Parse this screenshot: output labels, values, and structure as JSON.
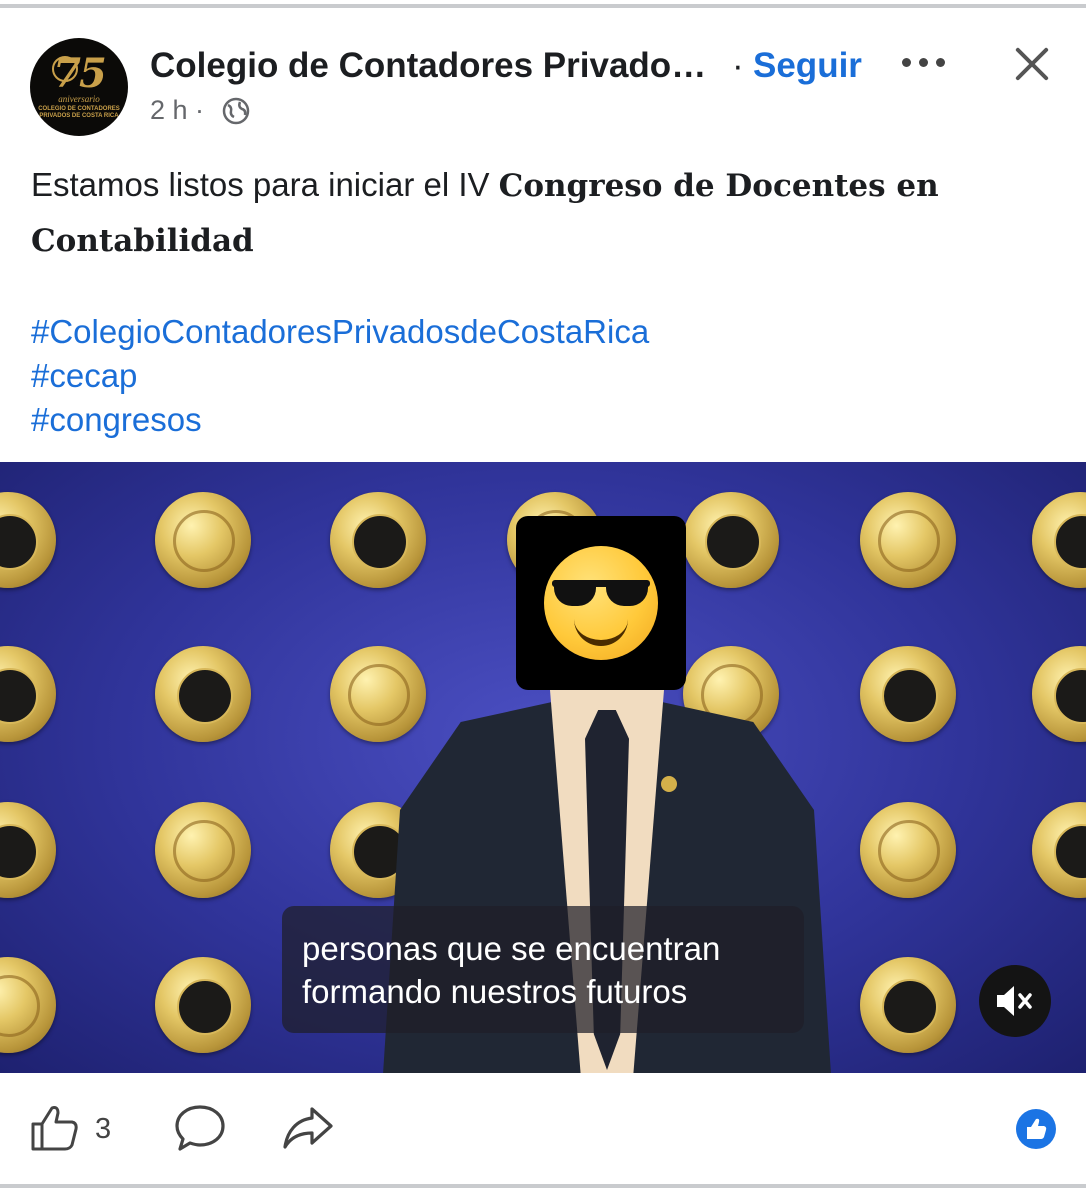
{
  "post": {
    "author": "Colegio de Contadores Privado…",
    "separator": "·",
    "follow_label": "Seguir",
    "time": "2 h ·",
    "text_intro": "Estamos listos para iniciar el IV ",
    "text_bold": "Congreso de Docentes en Contabilidad",
    "hashtags": [
      "#ColegioContadoresPrivadosdeCostaRica",
      "#cecap",
      "#congresos"
    ]
  },
  "avatar": {
    "number": "75",
    "subtitle": "aniversario",
    "org": "COLEGIO DE CONTADORES PRIVADOS DE COSTA RICA"
  },
  "video": {
    "caption_line1": "personas que se encuentran",
    "caption_line2": "formando nuestros futuros",
    "muted": true
  },
  "actions": {
    "like_count": "3"
  },
  "colors": {
    "link": "#1a6ed8",
    "reaction": "#1b74e4",
    "video_bg": "#30349a"
  }
}
